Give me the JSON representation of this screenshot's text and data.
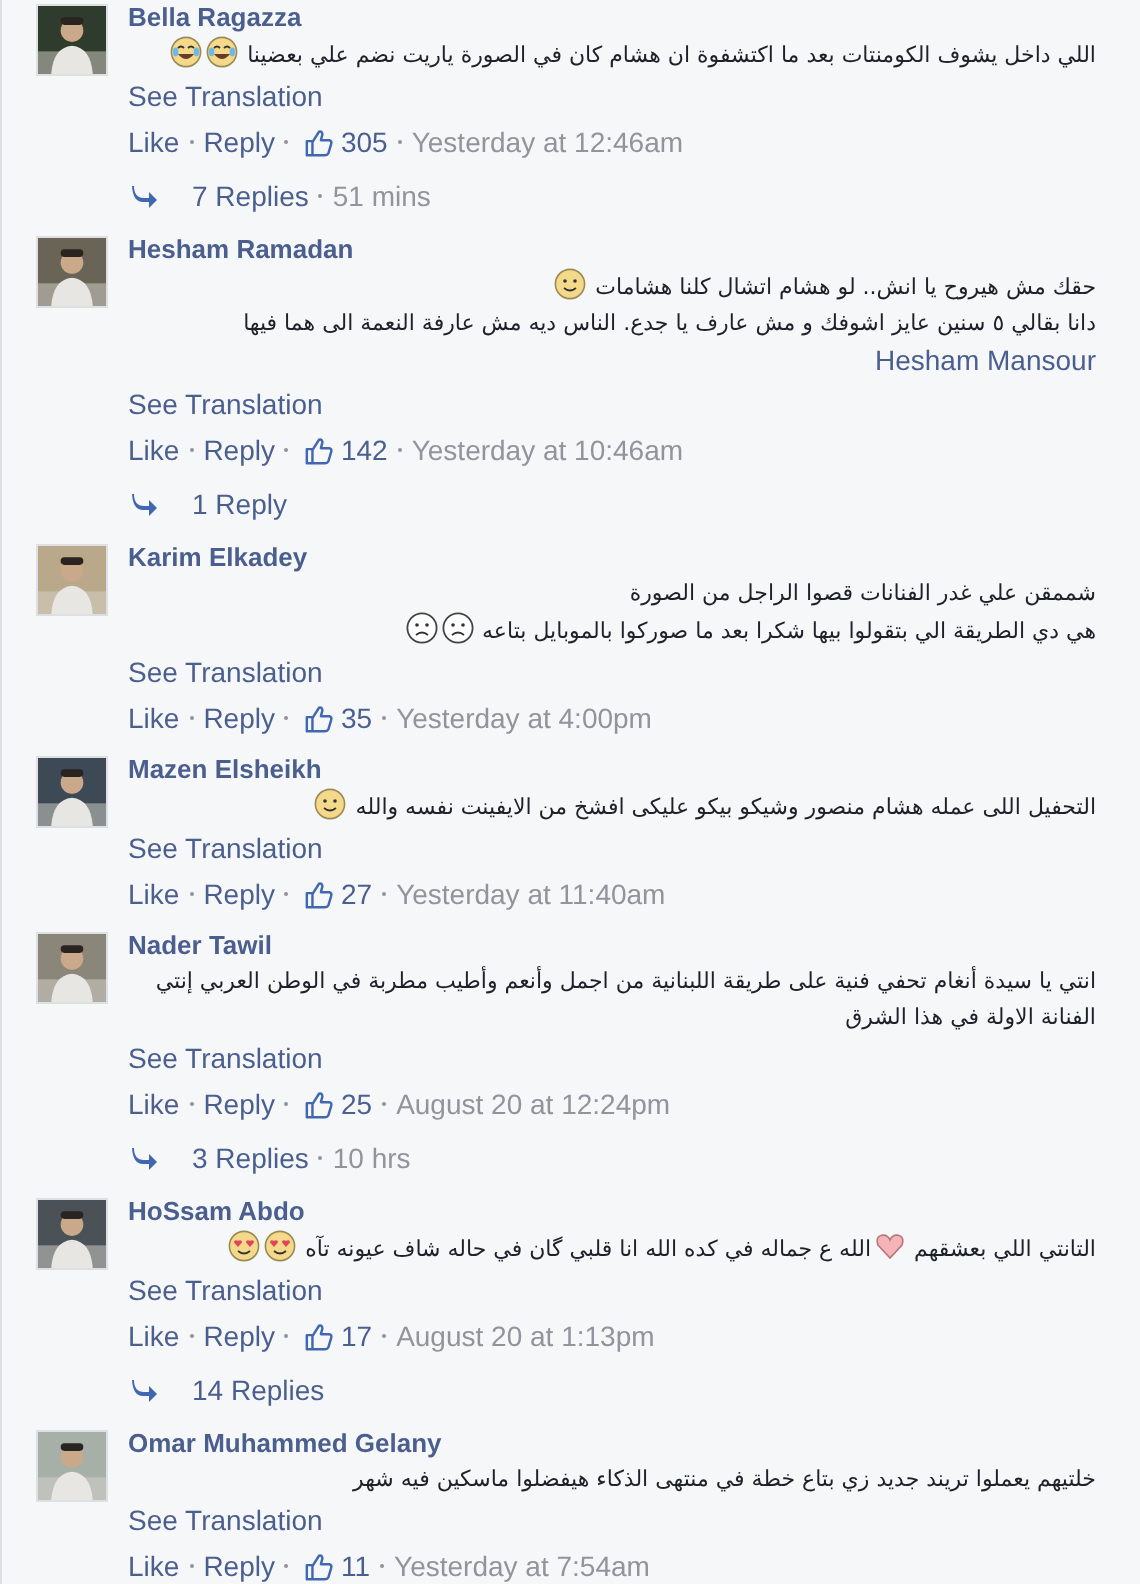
{
  "comments": [
    {
      "author": "Bella Ragazza",
      "lines": [
        [
          {
            "kind": "text",
            "text": "اللي داخل يشوف الكومنتات بعد ما اكتشفوة ان هشام كان في الصورة ياريت نضم علي بعضينا"
          },
          {
            "kind": "laughing"
          },
          {
            "kind": "laughing"
          }
        ]
      ],
      "see_translation": "See Translation",
      "like": "Like",
      "reply": "Reply",
      "likes": "305",
      "time": "Yesterday at 12:46am",
      "replies": {
        "label": "7 Replies",
        "time": "51 mins"
      }
    },
    {
      "author": "Hesham Ramadan",
      "lines": [
        [
          {
            "kind": "text",
            "text": "حقك مش هيروح يا انش.. لو هشام اتشال كلنا هشامات"
          },
          {
            "kind": "smiley"
          }
        ],
        [
          {
            "kind": "text",
            "text": "دانا بقالي ٥ سنين عايز اشوفك و مش عارف يا جدع. الناس ديه مش عارفة النعمة الى هما فيها"
          },
          {
            "kind": "mention",
            "text": "Hesham Mansour"
          }
        ]
      ],
      "see_translation": "See Translation",
      "like": "Like",
      "reply": "Reply",
      "likes": "142",
      "time": "Yesterday at 10:46am",
      "replies": {
        "label": "1 Reply"
      }
    },
    {
      "author": "Karim Elkadey",
      "lines": [
        [
          {
            "kind": "text",
            "text": "شممقن علي غدر الفنانات قصوا الراجل من الصورة"
          }
        ],
        [
          {
            "kind": "text",
            "text": "هي دي الطريقة الي بتقولوا بيها شكرا بعد ما صوركوا بالموبايل بتاعه"
          },
          {
            "kind": "sad"
          },
          {
            "kind": "sad"
          }
        ]
      ],
      "see_translation": "See Translation",
      "like": "Like",
      "reply": "Reply",
      "likes": "35",
      "time": "Yesterday at 4:00pm"
    },
    {
      "author": "Mazen Elsheikh",
      "lines": [
        [
          {
            "kind": "text",
            "text": "التحفيل اللى عمله هشام منصور وشيكو بيكو عليكى افشخ من الايفينت نفسه والله"
          },
          {
            "kind": "smiley"
          }
        ]
      ],
      "see_translation": "See Translation",
      "like": "Like",
      "reply": "Reply",
      "likes": "27",
      "time": "Yesterday at 11:40am"
    },
    {
      "author": "Nader Tawil",
      "lines": [
        [
          {
            "kind": "text",
            "text": "انتي يا سيدة أنغام تحفي فنية على طريقة اللبنانية من اجمل وأنعم وأطيب مطربة في الوطن العربي إنتي الفنانة الاولة في هذا الشرق"
          }
        ]
      ],
      "see_translation": "See Translation",
      "like": "Like",
      "reply": "Reply",
      "likes": "25",
      "time": "August 20 at 12:24pm",
      "replies": {
        "label": "3 Replies",
        "time": "10 hrs"
      }
    },
    {
      "author": "HoSsam Abdo",
      "lines": [
        [
          {
            "kind": "text",
            "text": "التانتي اللي بعشقهم"
          },
          {
            "kind": "heart"
          },
          {
            "kind": "text",
            "text": "الله ع جماله في كده الله انا قلبي گان في حاله شاف عيونه تآه"
          },
          {
            "kind": "hearteyes"
          },
          {
            "kind": "hearteyes"
          }
        ]
      ],
      "see_translation": "See Translation",
      "like": "Like",
      "reply": "Reply",
      "likes": "17",
      "time": "August 20 at 1:13pm",
      "replies": {
        "label": "14 Replies"
      }
    },
    {
      "author": "Omar Muhammed Gelany",
      "lines": [
        [
          {
            "kind": "text",
            "text": "خلتيهم يعملوا تريند جديد زي بتاع خطة في منتهى الذكاء هيفضلوا ماسكين فيه شهر"
          }
        ]
      ],
      "see_translation": "See Translation",
      "like": "Like",
      "reply": "Reply",
      "likes": "11",
      "time": "Yesterday at 7:54am"
    }
  ]
}
